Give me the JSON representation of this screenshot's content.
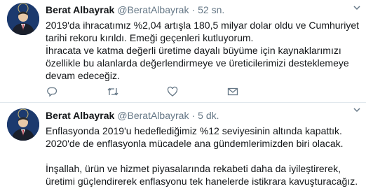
{
  "tweets": [
    {
      "author_name": "Berat Albayrak",
      "handle": "@BeratAlbayrak",
      "separator": "·",
      "time": "52 sn.",
      "text": "2019'da ihracatımız %2,04 artışla 180,5 milyar dolar oldu ve Cumhuriyet tarihi rekoru kırıldı. Emeği geçenleri kutluyorum.\nİhracata ve katma değerli üretime dayalı büyüme için kaynaklarımızı özellikle bu alanlarda değerlendirmeye ve üreticilerimizi desteklemeye devam edeceğiz.",
      "actions": [
        "reply-icon",
        "retweet-icon",
        "like-icon",
        "direct-message-icon"
      ]
    },
    {
      "author_name": "Berat Albayrak",
      "handle": "@BeratAlbayrak",
      "separator": "·",
      "time": "5 dk.",
      "text": "Enflasyonda 2019'u hedeflediğimiz %12 seviyesinin altında kapattık. 2020'de de enflasyonla mücadele ana gündemlerimizden biri olacak.\n\nİnşallah, ürün ve hizmet piyasalarında rekabeti daha da iyileştirerek, üretimi güçlendirerek enflasyonu tek hanelerde istikrara kavuşturacağız."
    }
  ],
  "colors": {
    "text": "#14171a",
    "secondary": "#657786",
    "divider": "#e1e8ed",
    "avatar_bg": "#1c3a6e"
  }
}
